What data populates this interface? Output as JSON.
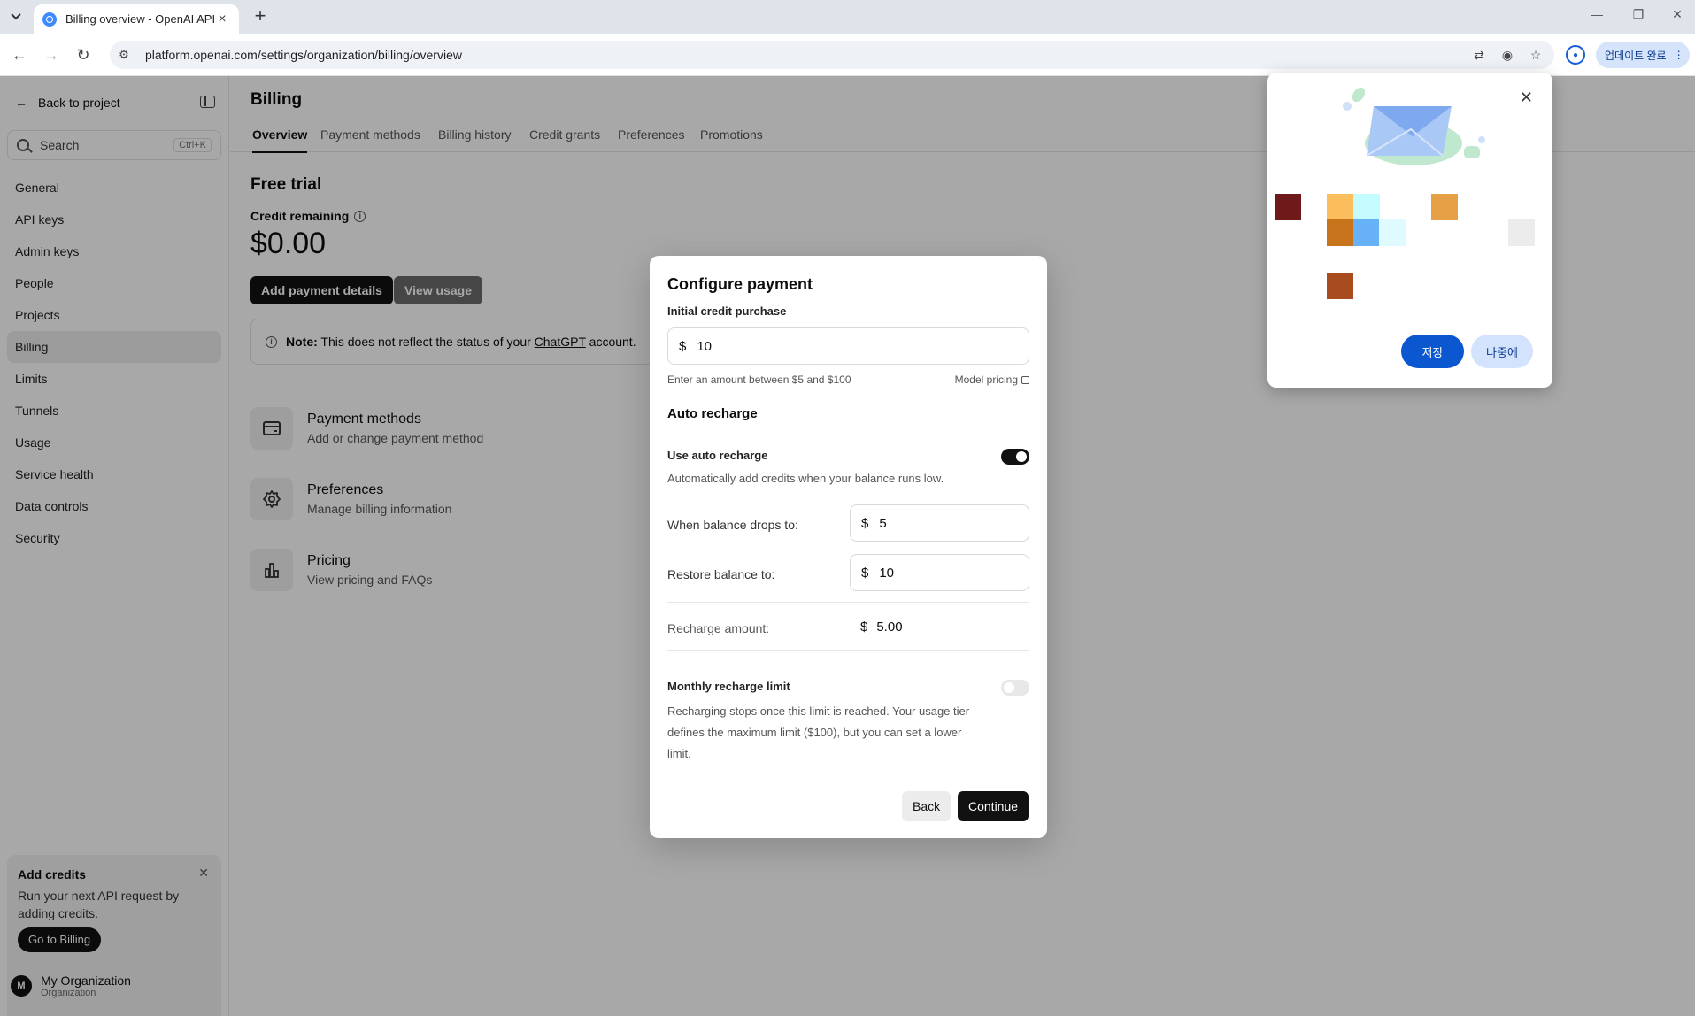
{
  "browser": {
    "tab_title": "Billing overview - OpenAI API",
    "url": "platform.openai.com/settings/organization/billing/overview",
    "update_label": "업데이트 완료"
  },
  "sidebar": {
    "back_label": "Back to project",
    "search_placeholder": "Search",
    "search_shortcut": "Ctrl+K",
    "items": [
      {
        "label": "General"
      },
      {
        "label": "API keys"
      },
      {
        "label": "Admin keys"
      },
      {
        "label": "People"
      },
      {
        "label": "Projects"
      },
      {
        "label": "Billing",
        "active": true
      },
      {
        "label": "Limits"
      },
      {
        "label": "Tunnels"
      },
      {
        "label": "Usage"
      },
      {
        "label": "Service health"
      },
      {
        "label": "Data controls"
      },
      {
        "label": "Security"
      }
    ],
    "promo": {
      "title": "Add credits",
      "text": "Run your next API request by adding credits.",
      "button": "Go to Billing"
    },
    "org": {
      "avatar": "M",
      "name": "My Organization",
      "sub": "Organization"
    }
  },
  "main": {
    "title": "Billing",
    "tabs": [
      "Overview",
      "Payment methods",
      "Billing history",
      "Credit grants",
      "Preferences",
      "Promotions"
    ],
    "plan": "Free trial",
    "credit_label": "Credit remaining",
    "balance": "$0.00",
    "add_payment": "Add payment details",
    "view_usage": "View usage",
    "note_bold": "Note:",
    "note_text": "This does not reflect the status of your",
    "note_link": "ChatGPT",
    "note_end": "account.",
    "cards": [
      {
        "title": "Payment methods",
        "sub": "Add or change payment method",
        "icon": "card-icon"
      },
      {
        "title": "Preferences",
        "sub": "Manage billing information",
        "icon": "gear-icon"
      },
      {
        "title": "Pricing",
        "sub": "View pricing and FAQs",
        "icon": "chart-icon"
      }
    ]
  },
  "modal": {
    "title": "Configure payment",
    "initial_label": "Initial credit purchase",
    "currency": "$",
    "initial_value": "10",
    "help": "Enter an amount between $5 and $100",
    "pricing_link": "Model pricing",
    "auto_title": "Auto recharge",
    "use_auto_label": "Use auto recharge",
    "use_auto_desc": "Automatically add credits when your balance runs low.",
    "use_auto_on": true,
    "drop_label": "When balance drops to:",
    "drop_value": "5",
    "restore_label": "Restore balance to:",
    "restore_value": "10",
    "recharge_label": "Recharge amount:",
    "recharge_value": "5.00",
    "monthly_label": "Monthly recharge limit",
    "monthly_desc": "Recharging stops once this limit is reached. Your usage tier defines the maximum limit ($100), but you can set a lower limit.",
    "monthly_on": false,
    "back": "Back",
    "continue": "Continue"
  },
  "popup": {
    "save": "저장",
    "later": "나중에"
  }
}
